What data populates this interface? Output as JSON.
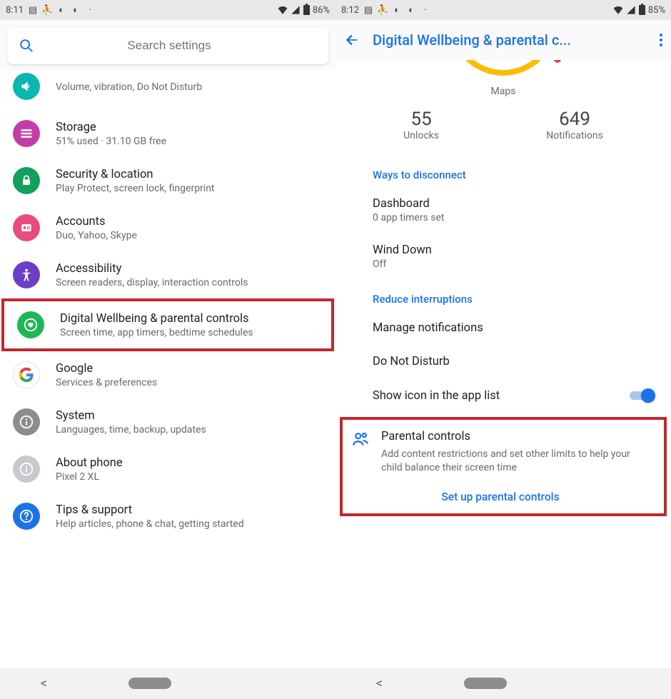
{
  "screen1": {
    "status": {
      "time": "8:11",
      "battery": "86%"
    },
    "search_placeholder": "Search settings",
    "items": [
      {
        "icon": "sound",
        "title": "",
        "sub": "Volume, vibration, Do Not Disturb"
      },
      {
        "icon": "storage",
        "title": "Storage",
        "sub": "51% used · 31.10 GB free"
      },
      {
        "icon": "security",
        "title": "Security & location",
        "sub": "Play Protect, screen lock, fingerprint"
      },
      {
        "icon": "accounts",
        "title": "Accounts",
        "sub": "Duo, Yahoo, Skype"
      },
      {
        "icon": "a11y",
        "title": "Accessibility",
        "sub": "Screen readers, display, interaction controls"
      },
      {
        "icon": "dw",
        "title": "Digital Wellbeing & parental controls",
        "sub": "Screen time, app timers, bedtime schedules",
        "highlight": true
      },
      {
        "icon": "google",
        "title": "Google",
        "sub": "Services & preferences"
      },
      {
        "icon": "system",
        "title": "System",
        "sub": "Languages, time, backup, updates"
      },
      {
        "icon": "about",
        "title": "About phone",
        "sub": "Pixel 2 XL"
      },
      {
        "icon": "tips",
        "title": "Tips & support",
        "sub": "Help articles, phone & chat, getting started"
      }
    ]
  },
  "screen2": {
    "status": {
      "time": "8:12",
      "battery": "85%"
    },
    "appbar_title": "Digital Wellbeing & parental c...",
    "maps_label": "Maps",
    "unlocks": {
      "value": "55",
      "label": "Unlocks"
    },
    "notifications": {
      "value": "649",
      "label": "Notifications"
    },
    "section1": "Ways to disconnect",
    "dashboard": {
      "t": "Dashboard",
      "s": "0 app timers set"
    },
    "winddown": {
      "t": "Wind Down",
      "s": "Off"
    },
    "section2": "Reduce interruptions",
    "manage_notifs": "Manage notifications",
    "dnd": "Do Not Disturb",
    "show_icon": "Show icon in the app list",
    "parental": {
      "title": "Parental controls",
      "desc": "Add content restrictions and set other limits to help your child balance their screen time",
      "link": "Set up parental controls"
    }
  }
}
